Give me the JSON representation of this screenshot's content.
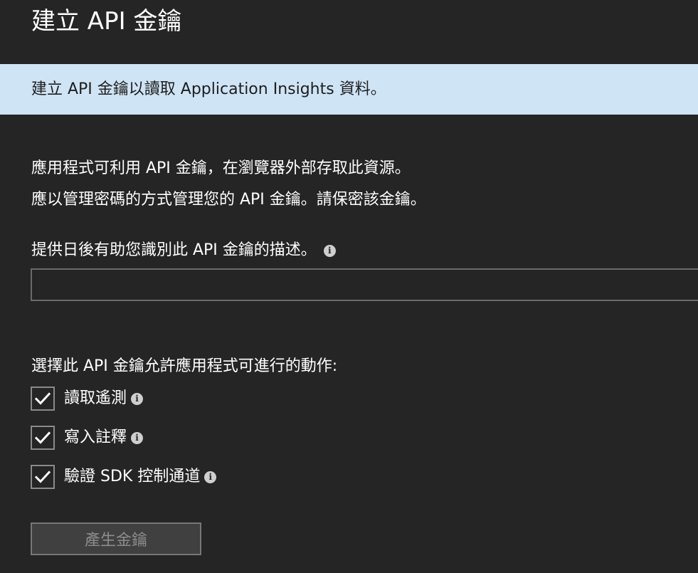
{
  "header": {
    "title": "建立 API 金鑰"
  },
  "banner": {
    "text": "建立 API 金鑰以讀取 Application Insights 資料。",
    "background": "#cfe4f5"
  },
  "intro": {
    "line1": "應用程式可利用 API 金鑰，在瀏覽器外部存取此資源。",
    "line2": "應以管理密碼的方式管理您的 API 金鑰。請保密該金鑰。"
  },
  "description": {
    "label": "提供日後有助您識別此 API 金鑰的描述。",
    "value": "",
    "info_icon": "info-icon"
  },
  "permissions": {
    "label": "選擇此 API 金鑰允許應用程式可進行的動作:",
    "items": [
      {
        "label": "讀取遙測",
        "checked": true
      },
      {
        "label": "寫入註釋",
        "checked": true
      },
      {
        "label": "驗證 SDK 控制通道",
        "checked": true
      }
    ]
  },
  "actions": {
    "generate_label": "產生金鑰",
    "generate_disabled": true
  },
  "colors": {
    "page_background": "#252525",
    "banner_background": "#cfe4f5",
    "text": "#ffffff",
    "disabled_text": "#8c8c8c"
  }
}
